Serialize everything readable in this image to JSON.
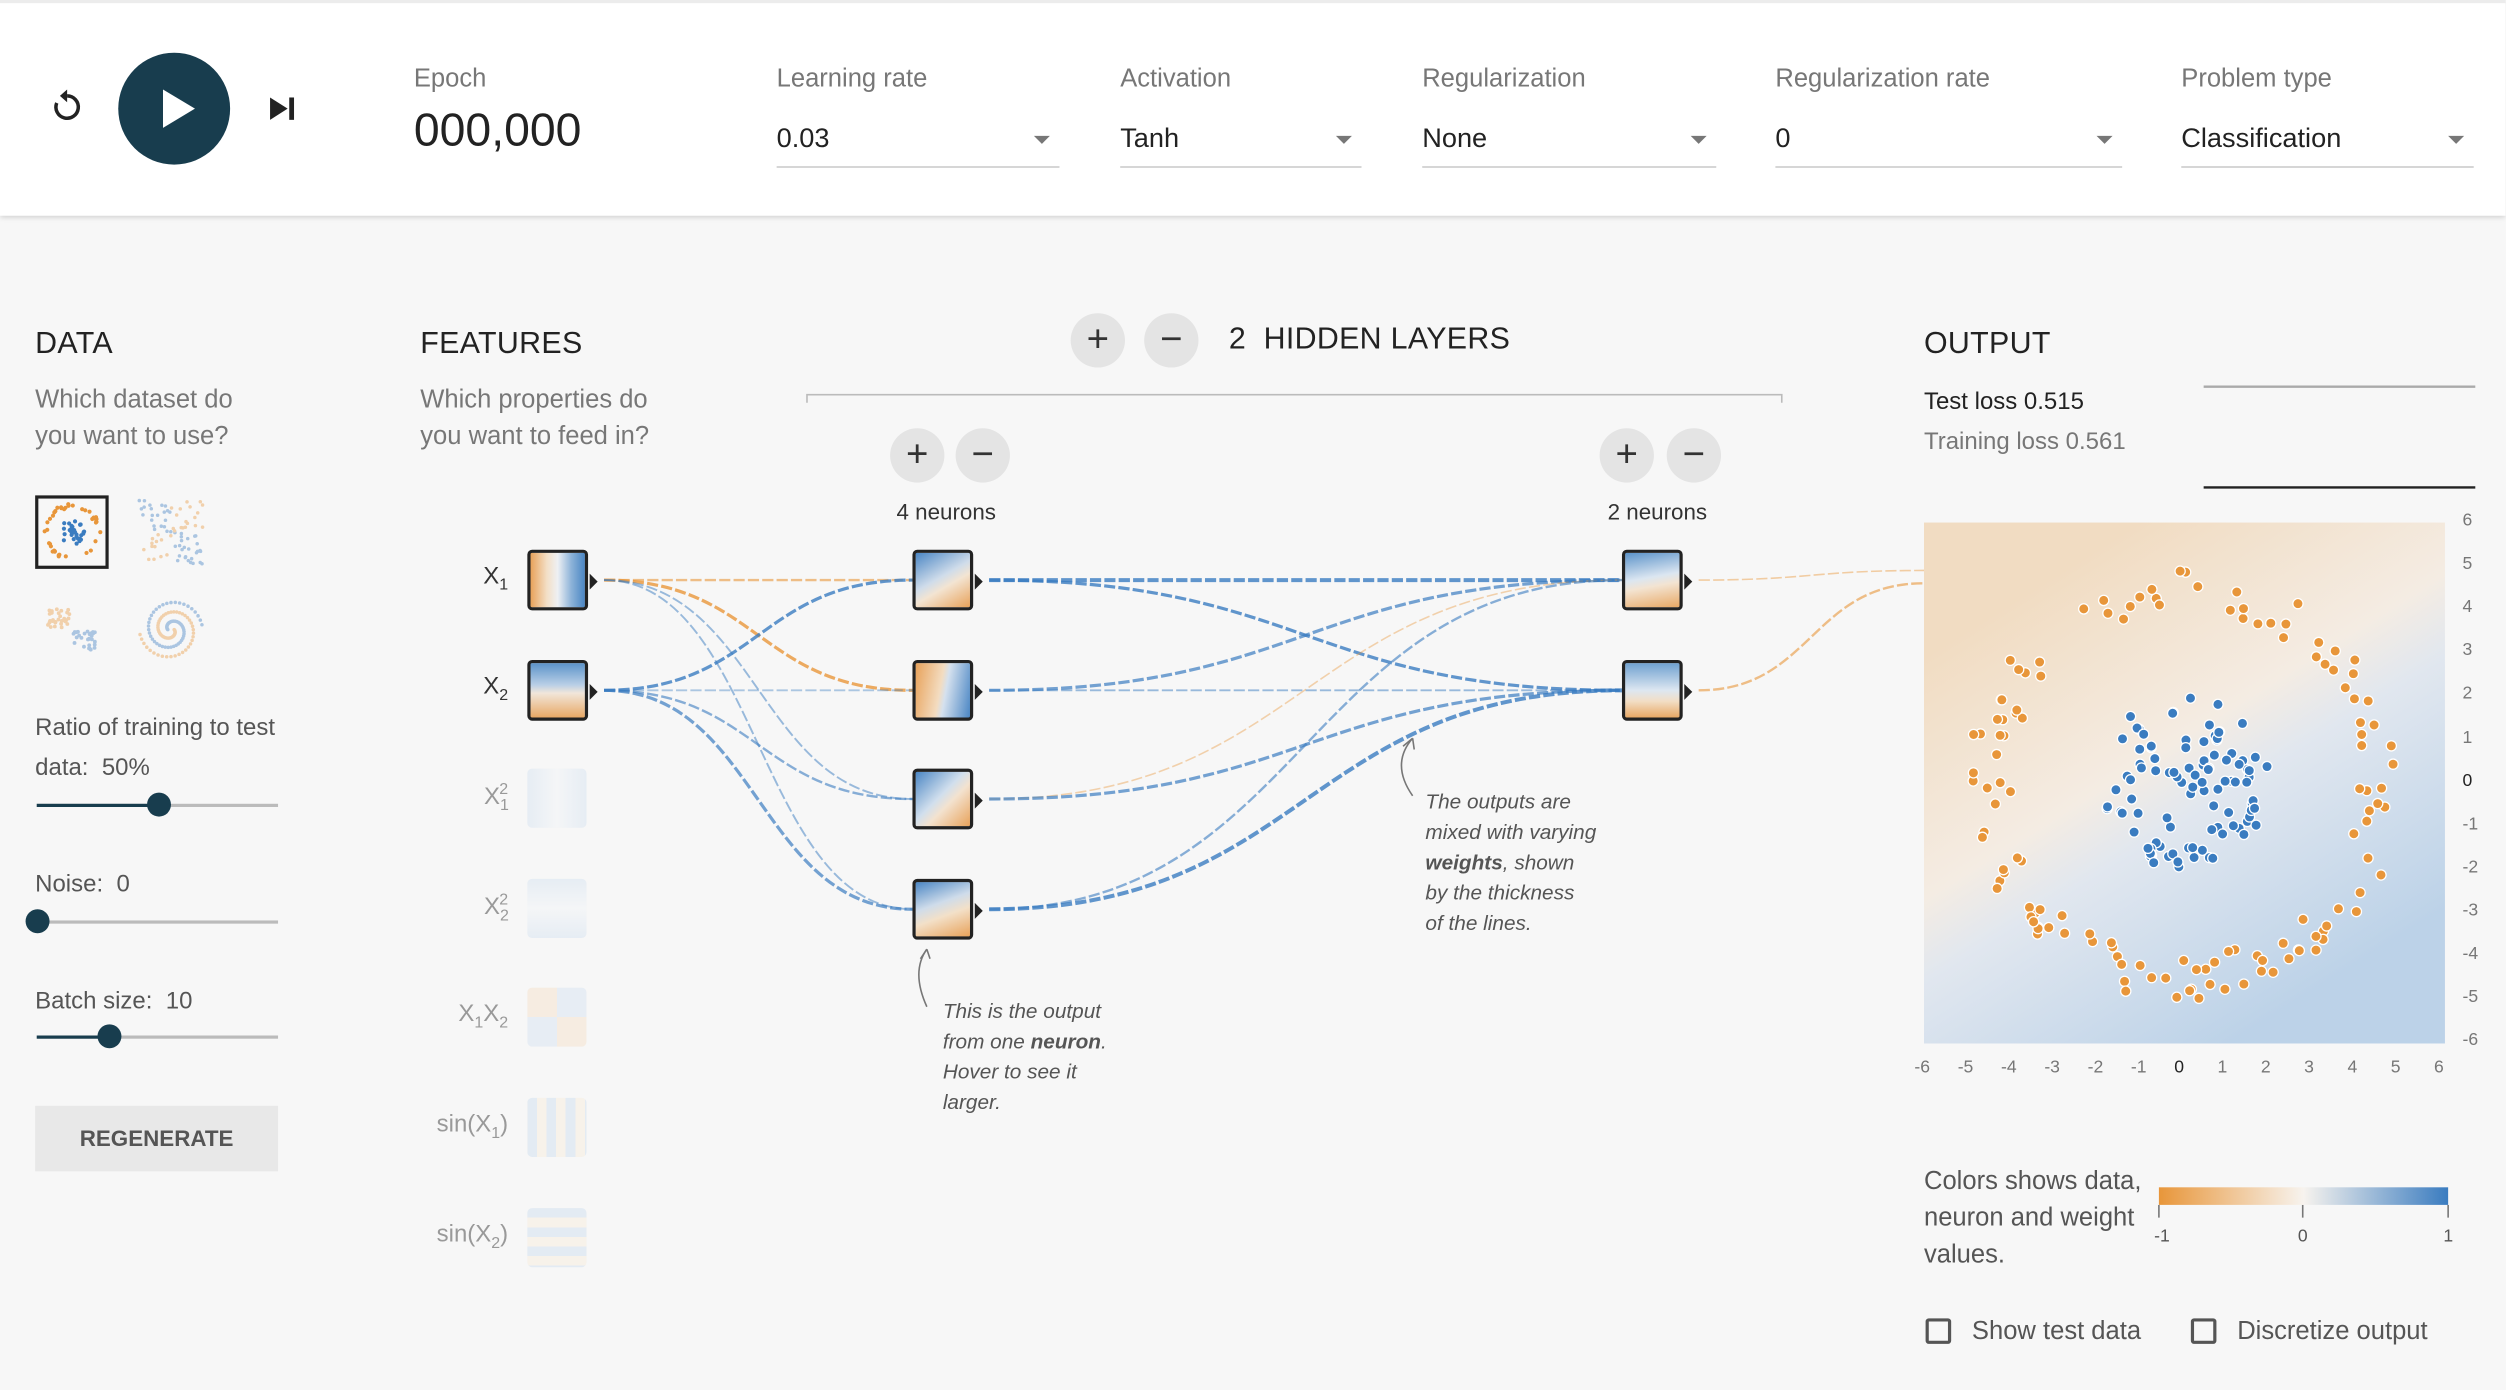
{
  "colors": {
    "accent": "#183d4e",
    "orange": "#e8963a",
    "blue": "#3a7cc0"
  },
  "controls": {
    "reset_icon": "reset-icon",
    "play_icon": "play-icon",
    "step_icon": "step-forward-icon",
    "epoch_label": "Epoch",
    "epoch_value": "000,000"
  },
  "settings": {
    "learning_rate": {
      "label": "Learning rate",
      "value": "0.03"
    },
    "activation": {
      "label": "Activation",
      "value": "Tanh"
    },
    "regularization": {
      "label": "Regularization",
      "value": "None"
    },
    "regularization_rate": {
      "label": "Regularization rate",
      "value": "0"
    },
    "problem_type": {
      "label": "Problem type",
      "value": "Classification"
    }
  },
  "data": {
    "title": "DATA",
    "subtitle": "Which dataset do you want to use?",
    "datasets": [
      "circle",
      "exclusive-or",
      "gaussian",
      "spiral"
    ],
    "selected_dataset": "circle",
    "ratio_label": "Ratio of training to test data:",
    "ratio_value": "50%",
    "ratio_level": 50,
    "noise_label": "Noise:",
    "noise_value": "0",
    "noise_level": 0,
    "batch_label": "Batch size:",
    "batch_value": "10",
    "batch_level": 30,
    "regenerate": "REGENERATE"
  },
  "features": {
    "title": "FEATURES",
    "subtitle": "Which properties do you want to feed in?",
    "items": [
      {
        "label": "X1",
        "base": "X",
        "sub": "1",
        "sup": "",
        "active": true,
        "pattern": "x1"
      },
      {
        "label": "X2",
        "base": "X",
        "sub": "2",
        "sup": "",
        "active": true,
        "pattern": "x2"
      },
      {
        "label": "X1^2",
        "base": "X",
        "sub": "1",
        "sup": "2",
        "active": false,
        "pattern": "x1sq"
      },
      {
        "label": "X2^2",
        "base": "X",
        "sub": "2",
        "sup": "2",
        "active": false,
        "pattern": "x2sq"
      },
      {
        "label": "X1X2",
        "base": "X",
        "sub": "1",
        "mid": "X",
        "sub2": "2",
        "active": false,
        "pattern": "x1x2"
      },
      {
        "label": "sin(X1)",
        "base": "sin(X",
        "sub": "1",
        "suffix": ")",
        "active": false,
        "pattern": "sinx1"
      },
      {
        "label": "sin(X2)",
        "base": "sin(X",
        "sub": "2",
        "suffix": ")",
        "active": false,
        "pattern": "sinx2"
      }
    ]
  },
  "network": {
    "layer_count": "2",
    "layers_label": "HIDDEN LAYERS",
    "layer1_neurons": "4 neurons",
    "layer2_neurons": "2 neurons",
    "annotation_neuron": [
      "This is the output",
      "from one ",
      "neuron",
      ".",
      "Hover to see it",
      "larger."
    ],
    "annotation_weights": [
      "The outputs are",
      "mixed with varying",
      "weights",
      ", shown",
      "by the thickness",
      "of the lines."
    ]
  },
  "output": {
    "title": "OUTPUT",
    "test_loss_label": "Test loss",
    "test_loss_value": "0.515",
    "training_loss_label": "Training loss",
    "training_loss_value": "0.561",
    "x_ticks": [
      "-6",
      "-5",
      "-4",
      "-3",
      "-2",
      "-1",
      "0",
      "1",
      "2",
      "3",
      "4",
      "5",
      "6"
    ],
    "y_ticks": [
      "6",
      "5",
      "4",
      "3",
      "2",
      "1",
      "0",
      "-1",
      "-2",
      "-3",
      "-4",
      "-5",
      "-6"
    ],
    "legend_text": "Colors shows data, neuron and weight values.",
    "legend_min": "-1",
    "legend_mid": "0",
    "legend_max": "1",
    "show_test_data": "Show test data",
    "discretize_output": "Discretize output"
  },
  "chart_data": {
    "type": "scatter",
    "xlim": [
      -6,
      6
    ],
    "ylim": [
      -6,
      6
    ],
    "series": [
      {
        "name": "-1",
        "color": "#e8963a",
        "distribution": "ring",
        "radius_range": [
          4,
          5
        ],
        "count": 130
      },
      {
        "name": "1",
        "color": "#3a7cc0",
        "distribution": "disc",
        "radius_range": [
          0,
          2
        ],
        "count": 100
      }
    ]
  }
}
